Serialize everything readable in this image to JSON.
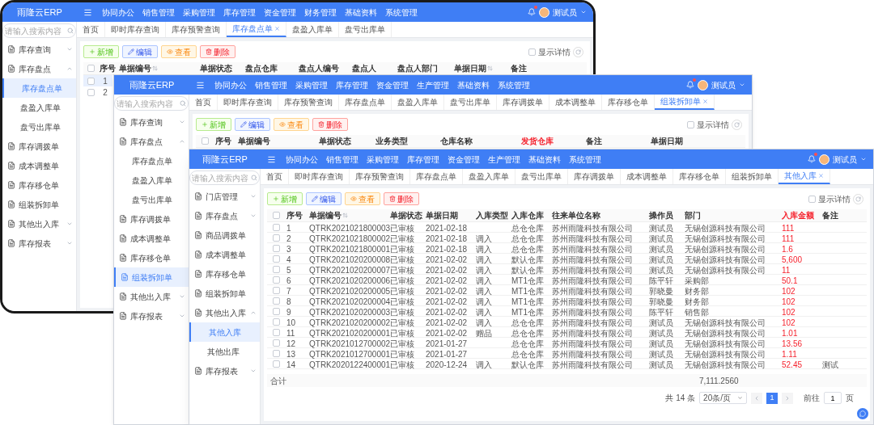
{
  "windows": [
    {
      "logo": "雨隆云ERP",
      "nav": [
        "协同办公",
        "销售管理",
        "采购管理",
        "库存管理",
        "资金管理",
        "财务管理",
        "基础资料",
        "系统管理"
      ],
      "user": "测试员",
      "search_placeholder": "请输入搜索内容",
      "sidebar": [
        {
          "label": "库存查询",
          "expanded": false,
          "selected": false
        },
        {
          "label": "库存盘点",
          "expanded": true,
          "selected": false,
          "children": [
            {
              "label": "库存盘点单",
              "selected": true
            },
            {
              "label": "盘盈入库单",
              "selected": false
            },
            {
              "label": "盘亏出库单",
              "selected": false
            }
          ]
        },
        {
          "label": "库存调拨单",
          "selected": false
        },
        {
          "label": "成本调整单",
          "selected": false
        },
        {
          "label": "库存移仓单",
          "selected": false
        },
        {
          "label": "组装拆卸单",
          "selected": false
        },
        {
          "label": "其他出入库",
          "expanded": false,
          "selected": false
        },
        {
          "label": "库存报表",
          "expanded": false,
          "selected": false
        }
      ],
      "tabs": [
        {
          "label": "首页",
          "selected": false
        },
        {
          "label": "即时库存查询",
          "selected": false
        },
        {
          "label": "库存预警查询",
          "selected": false
        },
        {
          "label": "库存盘点单",
          "selected": true
        },
        {
          "label": "盘盈入库单",
          "selected": false
        },
        {
          "label": "盘亏出库单",
          "selected": false
        }
      ],
      "toolbar": [
        {
          "label": "新增",
          "kind": "add"
        },
        {
          "label": "编辑",
          "kind": "edit"
        },
        {
          "label": "查看",
          "kind": "view"
        },
        {
          "label": "删除",
          "kind": "delete"
        }
      ],
      "show_details": {
        "label": "显示详情",
        "checked": false
      },
      "table": {
        "columns": [
          {
            "label": "序号",
            "sortable": false,
            "highlight": false
          },
          {
            "label": "单据编号",
            "sortable": true,
            "highlight": false
          },
          {
            "label": "单据状态",
            "sortable": false,
            "highlight": false
          },
          {
            "label": "盘点仓库",
            "sortable": false,
            "highlight": false
          },
          {
            "label": "盘点人编号",
            "sortable": false,
            "highlight": false
          },
          {
            "label": "盘点人",
            "sortable": false,
            "highlight": false
          },
          {
            "label": "盘点人部门",
            "sortable": false,
            "highlight": false
          },
          {
            "label": "单据日期",
            "sortable": true,
            "highlight": false
          },
          {
            "label": "备注",
            "sortable": false,
            "highlight": false
          }
        ],
        "select_all": {
          "checked": false
        },
        "rows": [
          {
            "index": "1",
            "selected": true,
            "checked": false
          },
          {
            "index": "2",
            "selected": false,
            "checked": false
          }
        ]
      }
    },
    {
      "logo": "雨隆云ERP",
      "nav": [
        "协同办公",
        "销售管理",
        "采购管理",
        "库存管理",
        "资金管理",
        "生产管理",
        "基础资料",
        "系统管理"
      ],
      "user": "测试员",
      "search_placeholder": "请输入搜索内容",
      "sidebar": [
        {
          "label": "库存查询",
          "expanded": false,
          "selected": false
        },
        {
          "label": "库存盘点",
          "expanded": true,
          "selected": false,
          "children": [
            {
              "label": "库存盘点单",
              "selected": false
            },
            {
              "label": "盘盈入库单",
              "selected": false
            },
            {
              "label": "盘亏出库单",
              "selected": false
            }
          ]
        },
        {
          "label": "库存调拨单",
          "selected": false
        },
        {
          "label": "成本调整单",
          "selected": false
        },
        {
          "label": "库存移仓单",
          "selected": false
        },
        {
          "label": "组装拆卸单",
          "selected": true
        },
        {
          "label": "其他出入库",
          "expanded": false,
          "selected": false
        },
        {
          "label": "库存报表",
          "expanded": false,
          "selected": false
        }
      ],
      "tabs": [
        {
          "label": "首页",
          "selected": false
        },
        {
          "label": "即时库存查询",
          "selected": false
        },
        {
          "label": "库存预警查询",
          "selected": false
        },
        {
          "label": "库存盘点单",
          "selected": false
        },
        {
          "label": "盘盈入库单",
          "selected": false
        },
        {
          "label": "盘亏出库单",
          "selected": false
        },
        {
          "label": "库存调拨单",
          "selected": false
        },
        {
          "label": "成本调整单",
          "selected": false
        },
        {
          "label": "库存移仓单",
          "selected": false
        },
        {
          "label": "组装拆卸单",
          "selected": true
        }
      ],
      "toolbar": [
        {
          "label": "新增",
          "kind": "add"
        },
        {
          "label": "编辑",
          "kind": "edit"
        },
        {
          "label": "查看",
          "kind": "view"
        },
        {
          "label": "删除",
          "kind": "delete"
        }
      ],
      "show_details": {
        "label": "显示详情",
        "checked": false
      },
      "table": {
        "columns": [
          {
            "label": "序号",
            "sortable": false,
            "highlight": false
          },
          {
            "label": "单据编号",
            "sortable": false,
            "highlight": false
          },
          {
            "label": "单据状态",
            "sortable": false,
            "highlight": false
          },
          {
            "label": "业务类型",
            "sortable": false,
            "highlight": false
          },
          {
            "label": "仓库名称",
            "sortable": false,
            "highlight": false
          },
          {
            "label": "发货仓库",
            "sortable": false,
            "highlight": true
          },
          {
            "label": "备注",
            "sortable": false,
            "highlight": false
          },
          {
            "label": "单据日期",
            "sortable": false,
            "highlight": false
          }
        ],
        "select_all": {
          "checked": false
        }
      }
    },
    {
      "logo": "雨隆云ERP",
      "nav": [
        "协同办公",
        "销售管理",
        "采购管理",
        "库存管理",
        "资金管理",
        "生产管理",
        "基础资料",
        "系统管理"
      ],
      "user": "测试员",
      "search_placeholder": "请输入搜索内容",
      "sidebar": [
        {
          "label": "门店管理",
          "expanded": false,
          "selected": false
        },
        {
          "label": "库存盘点",
          "expanded": false,
          "selected": false
        },
        {
          "label": "商品调拨单",
          "selected": false
        },
        {
          "label": "成本调整单",
          "selected": false
        },
        {
          "label": "库存移仓单",
          "selected": false
        },
        {
          "label": "组装拆卸单",
          "selected": false
        },
        {
          "label": "其他出入库",
          "expanded": true,
          "selected": false,
          "children": [
            {
              "label": "其他入库",
              "selected": true
            },
            {
              "label": "其他出库",
              "selected": false
            }
          ]
        },
        {
          "label": "库存报表",
          "expanded": false,
          "selected": false
        }
      ],
      "tabs": [
        {
          "label": "首页",
          "selected": false
        },
        {
          "label": "即时库存查询",
          "selected": false
        },
        {
          "label": "库存预警查询",
          "selected": false
        },
        {
          "label": "库存盘点单",
          "selected": false
        },
        {
          "label": "盘盈入库单",
          "selected": false
        },
        {
          "label": "盘亏出库单",
          "selected": false
        },
        {
          "label": "库存调拨单",
          "selected": false
        },
        {
          "label": "成本调整单",
          "selected": false
        },
        {
          "label": "库存移仓单",
          "selected": false
        },
        {
          "label": "组装拆卸单",
          "selected": false
        },
        {
          "label": "其他入库",
          "selected": true
        }
      ],
      "toolbar": [
        {
          "label": "新增",
          "kind": "add"
        },
        {
          "label": "编辑",
          "kind": "edit"
        },
        {
          "label": "查看",
          "kind": "view"
        },
        {
          "label": "删除",
          "kind": "delete"
        }
      ],
      "show_details": {
        "label": "显示详情",
        "checked": false
      },
      "table": {
        "columns": [
          {
            "label": "序号",
            "sortable": false,
            "highlight": false
          },
          {
            "label": "单据编号",
            "sortable": true,
            "highlight": false
          },
          {
            "label": "单据状态",
            "sortable": false,
            "highlight": false
          },
          {
            "label": "单据日期",
            "sortable": false,
            "highlight": false
          },
          {
            "label": "入库类型",
            "sortable": false,
            "highlight": false
          },
          {
            "label": "入库仓库",
            "sortable": false,
            "highlight": false
          },
          {
            "label": "往来单位名称",
            "sortable": false,
            "highlight": false
          },
          {
            "label": "操作员",
            "sortable": false,
            "highlight": false
          },
          {
            "label": "部门",
            "sortable": false,
            "highlight": false
          },
          {
            "label": "入库金额",
            "sortable": false,
            "highlight": true
          },
          {
            "label": "备注",
            "sortable": false,
            "highlight": false
          }
        ],
        "select_all": {
          "checked": false
        },
        "rows": [
          {
            "index": "1",
            "number": "QTRK2021021800003",
            "status": "已审核",
            "date": "2021-02-18",
            "warehouse": "总仓仓库",
            "partner": "苏州雨隆科技有限公司",
            "operator": "测试员",
            "department": "无锡创源科技有限公司",
            "amount": "111",
            "checked": false
          },
          {
            "index": "2",
            "number": "QTRK2021021800002",
            "status": "已审核",
            "date": "2021-02-18",
            "type": "调入",
            "warehouse": "总仓仓库",
            "partner": "苏州雨隆科技有限公司",
            "operator": "测试员",
            "department": "无锡创源科技有限公司",
            "amount": "111",
            "checked": false
          },
          {
            "index": "3",
            "number": "QTRK2021021800001",
            "status": "已审核",
            "date": "2021-02-18",
            "type": "调入",
            "warehouse": "总仓仓库",
            "partner": "苏州雨隆科技有限公司",
            "operator": "测试员",
            "department": "无锡创源科技有限公司",
            "amount": "1.6",
            "checked": false
          },
          {
            "index": "4",
            "number": "QTRK2021020200008",
            "status": "已审核",
            "date": "2021-02-02",
            "type": "调入",
            "warehouse": "默认仓库",
            "partner": "苏州雨隆科技有限公司",
            "operator": "测试员",
            "department": "无锡创源科技有限公司",
            "amount": "5,600",
            "checked": false
          },
          {
            "index": "5",
            "number": "QTRK2021020200007",
            "status": "已审核",
            "date": "2021-02-02",
            "type": "调入",
            "warehouse": "默认仓库",
            "partner": "苏州雨隆科技有限公司",
            "operator": "测试员",
            "department": "无锡创源科技有限公司",
            "amount": "11",
            "checked": false
          },
          {
            "index": "6",
            "number": "QTRK2021020200006",
            "status": "已审核",
            "date": "2021-02-02",
            "type": "调入",
            "warehouse": "MT1仓库",
            "partner": "苏州雨隆科技有限公司",
            "operator": "陈平轩",
            "department": "采购部",
            "amount": "50.1",
            "checked": false
          },
          {
            "index": "7",
            "number": "QTRK2021020200005",
            "status": "已审核",
            "date": "2021-02-02",
            "type": "调入",
            "warehouse": "MT1仓库",
            "partner": "苏州雨隆科技有限公司",
            "operator": "郭晓曼",
            "department": "财务部",
            "amount": "102",
            "checked": false
          },
          {
            "index": "8",
            "number": "QTRK2021020200004",
            "status": "已审核",
            "date": "2021-02-02",
            "type": "调入",
            "warehouse": "MT1仓库",
            "partner": "苏州雨隆科技有限公司",
            "operator": "郭晓曼",
            "department": "财务部",
            "amount": "102",
            "checked": false
          },
          {
            "index": "9",
            "number": "QTRK2021020200003",
            "status": "已审核",
            "date": "2021-02-02",
            "type": "调入",
            "warehouse": "MT1仓库",
            "partner": "苏州雨隆科技有限公司",
            "operator": "陈平轩",
            "department": "销售部",
            "amount": "102",
            "checked": false
          },
          {
            "index": "10",
            "number": "QTRK2021020200002",
            "status": "已审核",
            "date": "2021-02-02",
            "type": "调入",
            "warehouse": "总仓仓库",
            "partner": "苏州雨隆科技有限公司",
            "operator": "测试员",
            "department": "无锡创源科技有限公司",
            "amount": "102",
            "checked": false
          },
          {
            "index": "11",
            "number": "QTRK2021020200001",
            "status": "已审核",
            "date": "2021-02-02",
            "type": "赠品",
            "warehouse": "总仓仓库",
            "partner": "苏州雨隆科技有限公司",
            "operator": "测试员",
            "department": "无锡创源科技有限公司",
            "amount": "1.01",
            "checked": false
          },
          {
            "index": "12",
            "number": "QTRK2021012700002",
            "status": "已审核",
            "date": "2021-01-27",
            "warehouse": "总仓仓库",
            "partner": "苏州雨隆科技有限公司",
            "operator": "测试员",
            "department": "无锡创源科技有限公司",
            "amount": "13.56",
            "checked": false
          },
          {
            "index": "13",
            "number": "QTRK2021012700001",
            "status": "已审核",
            "date": "2021-01-27",
            "warehouse": "总仓仓库",
            "partner": "苏州雨隆科技有限公司",
            "operator": "测试员",
            "department": "无锡创源科技有限公司",
            "amount": "1.11",
            "checked": false
          },
          {
            "index": "14",
            "number": "QTRK2020122400001",
            "status": "已审核",
            "date": "2020-12-24",
            "type": "调入",
            "warehouse": "默认仓库",
            "partner": "苏州雨隆科技有限公司",
            "operator": "测试员",
            "department": "无锡创源科技有限公司",
            "amount": "52.45",
            "note": "测试",
            "checked": false
          }
        ],
        "footer": {
          "label": "合计",
          "total": "7,111.2560"
        }
      },
      "pagination": {
        "total": "共 14 条",
        "page_size": "20条/页",
        "pages": [
          {
            "label": "1",
            "selected": true
          }
        ],
        "goto_label": "前往",
        "goto_value": "1",
        "goto_suffix": "页"
      }
    }
  ]
}
